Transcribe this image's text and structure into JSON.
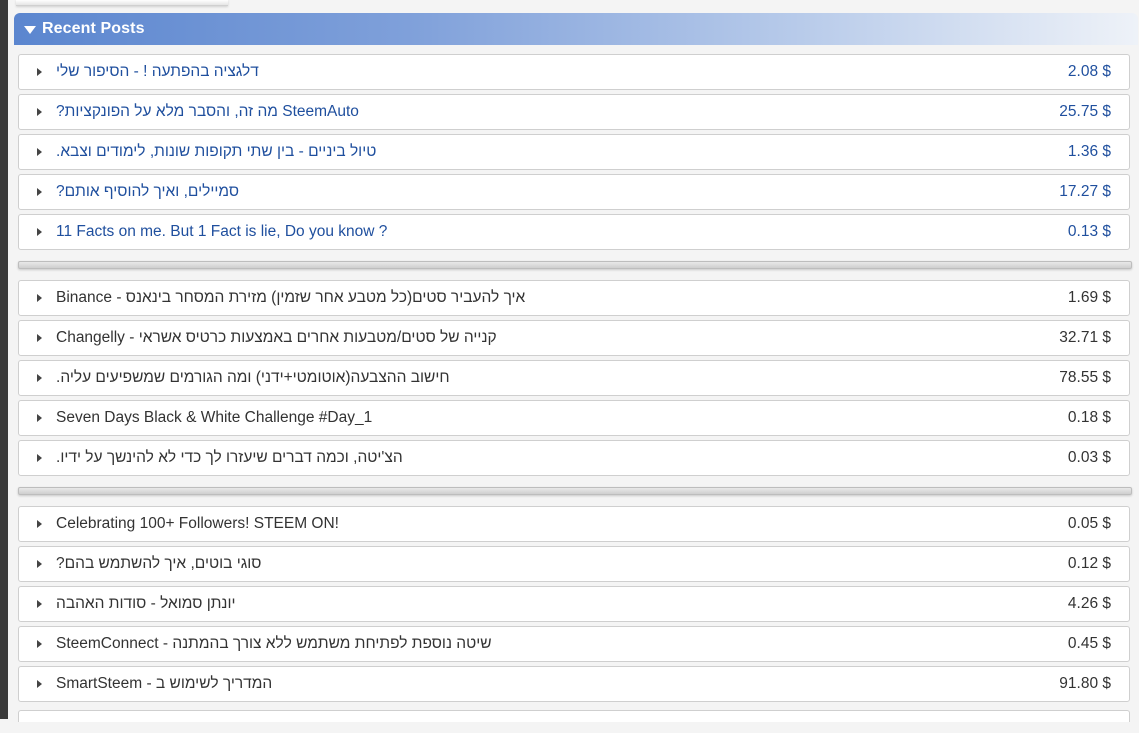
{
  "panel": {
    "title": "Recent Posts"
  },
  "groups": [
    {
      "style": "blue",
      "posts": [
        {
          "title": "דלגציה בהפתעה ! - הסיפור שלי",
          "value": "2.08 $"
        },
        {
          "title": "?מה זה, והסבר מלא על הפונקציות SteemAuto",
          "value": "25.75 $"
        },
        {
          "title": ".טיול ביניים - בין שתי תקופות שונות, לימודים וצבא",
          "value": "1.36 $"
        },
        {
          "title": "?סמיילים, ואיך להוסיף אותם",
          "value": "17.27 $"
        },
        {
          "title": "11 Facts on me. But 1 Fact is lie, Do you know ?",
          "value": "0.13 $"
        }
      ]
    },
    {
      "style": "dark",
      "posts": [
        {
          "title": "Binance - איך להעביר סטים(כל מטבע אחר שזמין) מזירת המסחר בינאנס",
          "value": "1.69 $"
        },
        {
          "title": "Changelly - קנייה של סטים/מטבעות אחרים באמצעות כרטיס אשראי",
          "value": "32.71 $"
        },
        {
          "title": ".חישוב ההצבעה(אוטומטי+ידני) ומה הגורמים שמשפיעים עליה",
          "value": "78.55 $"
        },
        {
          "title": "Seven Days Black & White Challenge #Day_1",
          "value": "0.18 $"
        },
        {
          "title": ".הצ'יטה, וכמה דברים שיעזרו לך כדי לא להינשך על ידיו",
          "value": "0.03 $"
        }
      ]
    },
    {
      "style": "dark",
      "posts": [
        {
          "title": "Celebrating 100+ Followers! STEEM ON!",
          "value": "0.05 $"
        },
        {
          "title": "?סוגי בוטים, איך להשתמש בהם",
          "value": "0.12 $"
        },
        {
          "title": "יונתן סמואל - סודות האהבה",
          "value": "4.26 $"
        },
        {
          "title": "SteemConnect - שיטה נוספת לפתיחת משתמש ללא צורך בהמתנה",
          "value": "0.45 $"
        },
        {
          "title": "SmartSteem - המדריך לשימוש ב",
          "value": "91.80 $"
        }
      ]
    }
  ]
}
